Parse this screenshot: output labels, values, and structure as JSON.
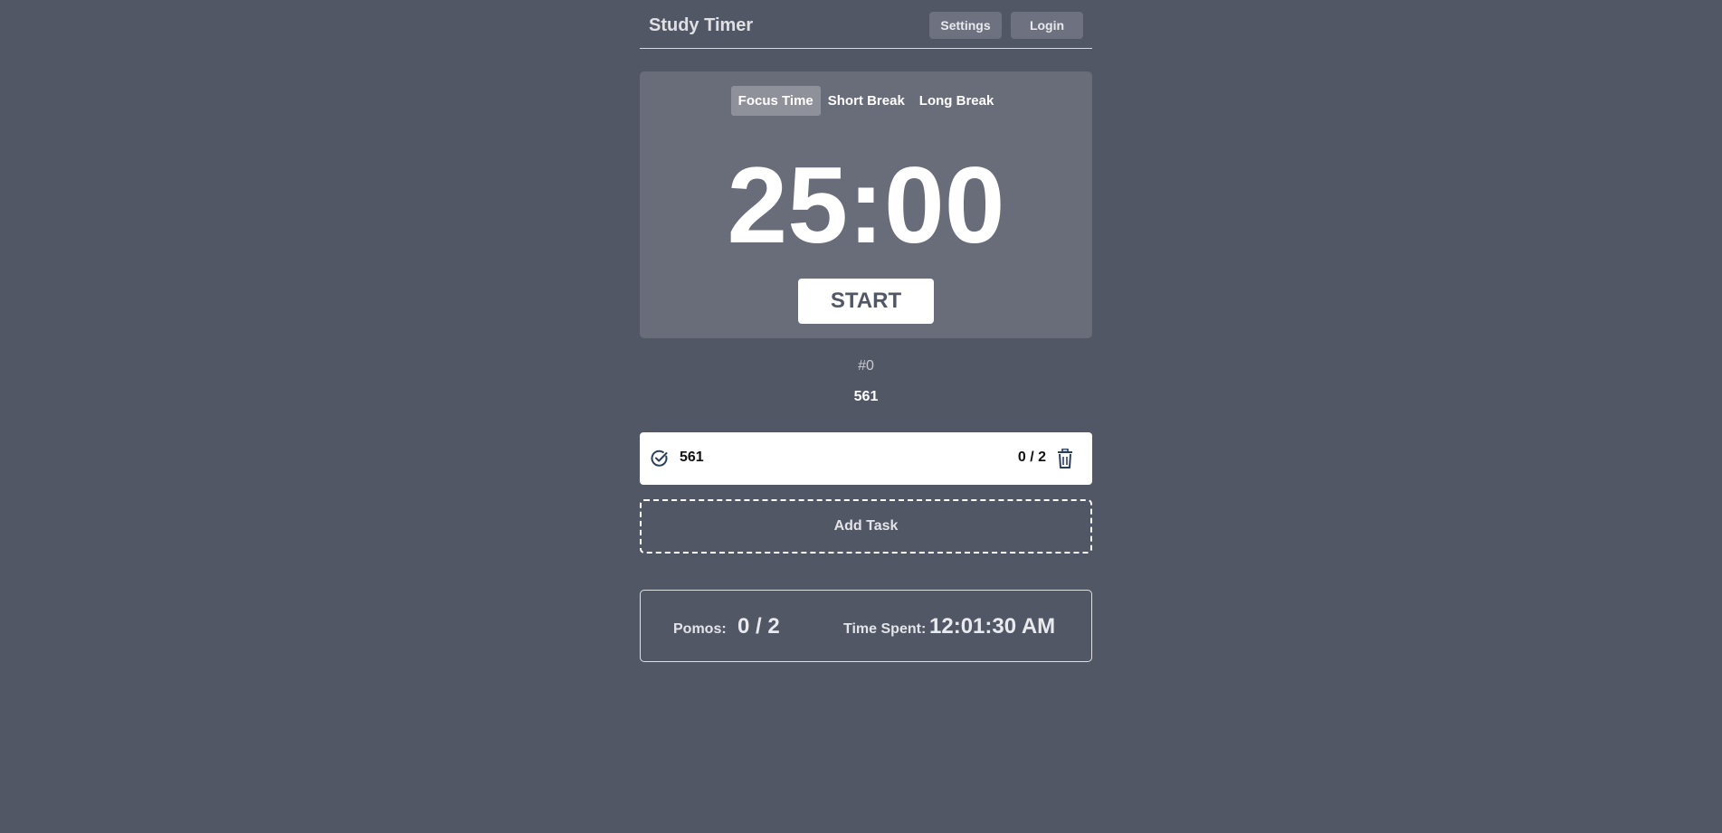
{
  "header": {
    "title": "Study Timer",
    "settings_label": "Settings",
    "login_label": "Login"
  },
  "timer": {
    "tabs": [
      {
        "label": "Focus Time",
        "active": true
      },
      {
        "label": "Short Break",
        "active": false
      },
      {
        "label": "Long Break",
        "active": false
      }
    ],
    "clock": "25:00",
    "start_label": "START"
  },
  "session": {
    "number": "#0",
    "current_task": "561"
  },
  "tasks": [
    {
      "name": "561",
      "progress": "0 / 2",
      "icon": "check-circle-icon"
    }
  ],
  "add_task_label": "Add Task",
  "stats": {
    "pomos_label": "Pomos:",
    "pomos_value": "0 / 2",
    "time_label": "Time Spent:",
    "time_value": "12:01:30 AM"
  },
  "colors": {
    "background": "#525765",
    "card": "#696c79",
    "active_tab": "#8e909a"
  }
}
